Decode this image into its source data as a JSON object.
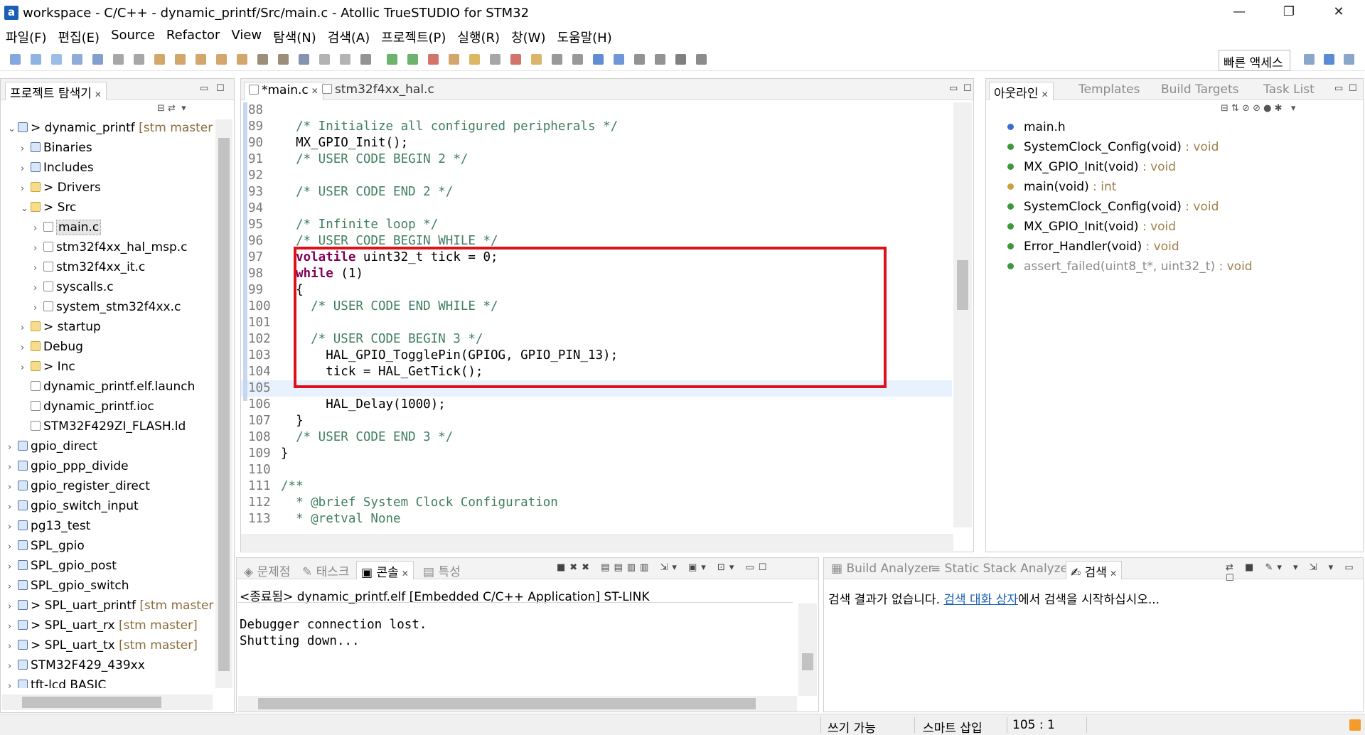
{
  "window": {
    "title": "workspace - C/C++ - dynamic_printf/Src/main.c - Atollic TrueSTUDIO for STM32",
    "logo": "a",
    "minimize": "—",
    "maximize": "❐",
    "close": "✕"
  },
  "menubar": [
    "파일(F)",
    "편집(E)",
    "Source",
    "Refactor",
    "View",
    "탐색(N)",
    "검색(A)",
    "프로젝트(P)",
    "실행(R)",
    "창(W)",
    "도움말(H)"
  ],
  "quick_access": "빠른 액세스",
  "explorer": {
    "tab_label": "프로젝트 탐색기",
    "items": [
      {
        "text": "dynamic_printf",
        "branch": "[stm master]",
        "prefix": "> ",
        "twisty": "v",
        "icon": "lib",
        "indent": 0
      },
      {
        "text": "Binaries",
        "branch": "",
        "prefix": "",
        "twisty": ">",
        "icon": "lib",
        "indent": 1
      },
      {
        "text": "Includes",
        "branch": "",
        "prefix": "",
        "twisty": ">",
        "icon": "lib",
        "indent": 1
      },
      {
        "text": "Drivers",
        "branch": "",
        "prefix": "> ",
        "twisty": ">",
        "icon": "fold",
        "indent": 1
      },
      {
        "text": "Src",
        "branch": "",
        "prefix": "> ",
        "twisty": "v",
        "icon": "fold",
        "indent": 1
      },
      {
        "text": "main.c",
        "branch": "",
        "prefix": "",
        "twisty": ">",
        "icon": "cfile",
        "indent": 2,
        "selected": true
      },
      {
        "text": "stm32f4xx_hal_msp.c",
        "branch": "",
        "prefix": "",
        "twisty": ">",
        "icon": "cfile",
        "indent": 2
      },
      {
        "text": "stm32f4xx_it.c",
        "branch": "",
        "prefix": "",
        "twisty": ">",
        "icon": "cfile",
        "indent": 2
      },
      {
        "text": "syscalls.c",
        "branch": "",
        "prefix": "",
        "twisty": ">",
        "icon": "cfile",
        "indent": 2
      },
      {
        "text": "system_stm32f4xx.c",
        "branch": "",
        "prefix": "",
        "twisty": ">",
        "icon": "cfile",
        "indent": 2
      },
      {
        "text": "startup",
        "branch": "",
        "prefix": "> ",
        "twisty": ">",
        "icon": "fold",
        "indent": 1
      },
      {
        "text": "Debug",
        "branch": "",
        "prefix": "",
        "twisty": ">",
        "icon": "fold",
        "indent": 1
      },
      {
        "text": "Inc",
        "branch": "",
        "prefix": "> ",
        "twisty": ">",
        "icon": "fold",
        "indent": 1
      },
      {
        "text": "dynamic_printf.elf.launch",
        "branch": "",
        "prefix": "",
        "twisty": "",
        "icon": "cfile",
        "indent": 1
      },
      {
        "text": "dynamic_printf.ioc",
        "branch": "",
        "prefix": "",
        "twisty": "",
        "icon": "cfile",
        "indent": 1
      },
      {
        "text": "STM32F429ZI_FLASH.ld",
        "branch": "",
        "prefix": "",
        "twisty": "",
        "icon": "cfile",
        "indent": 1
      },
      {
        "text": "gpio_direct",
        "branch": "",
        "prefix": "",
        "twisty": ">",
        "icon": "lib",
        "indent": 0
      },
      {
        "text": "gpio_ppp_divide",
        "branch": "",
        "prefix": "",
        "twisty": ">",
        "icon": "lib",
        "indent": 0
      },
      {
        "text": "gpio_register_direct",
        "branch": "",
        "prefix": "",
        "twisty": ">",
        "icon": "lib",
        "indent": 0
      },
      {
        "text": "gpio_switch_input",
        "branch": "",
        "prefix": "",
        "twisty": ">",
        "icon": "lib",
        "indent": 0
      },
      {
        "text": "pg13_test",
        "branch": "",
        "prefix": "",
        "twisty": ">",
        "icon": "lib",
        "indent": 0
      },
      {
        "text": "SPL_gpio",
        "branch": "",
        "prefix": "",
        "twisty": ">",
        "icon": "lib",
        "indent": 0
      },
      {
        "text": "SPL_gpio_post",
        "branch": "",
        "prefix": "",
        "twisty": ">",
        "icon": "lib",
        "indent": 0
      },
      {
        "text": "SPL_gpio_switch",
        "branch": "",
        "prefix": "",
        "twisty": ">",
        "icon": "lib",
        "indent": 0
      },
      {
        "text": "SPL_uart_printf",
        "branch": "[stm master]",
        "prefix": "> ",
        "twisty": ">",
        "icon": "lib",
        "indent": 0
      },
      {
        "text": "SPL_uart_rx",
        "branch": "[stm master]",
        "prefix": "> ",
        "twisty": ">",
        "icon": "lib",
        "indent": 0
      },
      {
        "text": "SPL_uart_tx",
        "branch": "[stm master]",
        "prefix": "> ",
        "twisty": ">",
        "icon": "lib",
        "indent": 0
      },
      {
        "text": "STM32F429_439xx",
        "branch": "",
        "prefix": "",
        "twisty": ">",
        "icon": "lib",
        "indent": 0
      },
      {
        "text": "tft-lcd BASIC",
        "branch": "",
        "prefix": "",
        "twisty": ">",
        "icon": "lib",
        "indent": 0
      }
    ]
  },
  "editor": {
    "tabs": [
      "*main.c",
      "stm32f4xx_hal.c"
    ],
    "lines": [
      {
        "n": "88",
        "code": ""
      },
      {
        "n": "89",
        "code": "  /* Initialize all configured peripherals */",
        "cls": "cm"
      },
      {
        "n": "90",
        "code": "  MX_GPIO_Init();"
      },
      {
        "n": "91",
        "code": "  /* USER CODE BEGIN 2 */",
        "cls": "cm"
      },
      {
        "n": "92",
        "code": ""
      },
      {
        "n": "93",
        "code": "  /* USER CODE END 2 */",
        "cls": "cm"
      },
      {
        "n": "94",
        "code": ""
      },
      {
        "n": "95",
        "code": "  /* Infinite loop */",
        "cls": "cm"
      },
      {
        "n": "96",
        "code": "  /* USER CODE BEGIN WHILE */",
        "cls": "cm"
      },
      {
        "n": "97",
        "code": "  volatile uint32_t tick = 0;",
        "kw": "volatile"
      },
      {
        "n": "98",
        "code": "  while (1)",
        "kw": "while"
      },
      {
        "n": "99",
        "code": "  {"
      },
      {
        "n": "100",
        "code": "    /* USER CODE END WHILE */",
        "cls": "cm"
      },
      {
        "n": "101",
        "code": ""
      },
      {
        "n": "102",
        "code": "    /* USER CODE BEGIN 3 */",
        "cls": "cm"
      },
      {
        "n": "103",
        "code": "      HAL_GPIO_TogglePin(GPIOG, GPIO_PIN_13);"
      },
      {
        "n": "104",
        "code": "      tick = HAL_GetTick();"
      },
      {
        "n": "105",
        "code": ""
      },
      {
        "n": "106",
        "code": "      HAL_Delay(1000);"
      },
      {
        "n": "107",
        "code": "  }"
      },
      {
        "n": "108",
        "code": "  /* USER CODE END 3 */",
        "cls": "cm"
      },
      {
        "n": "109",
        "code": "}"
      },
      {
        "n": "110",
        "code": ""
      },
      {
        "n": "111",
        "code": "/**",
        "cls": "cm"
      },
      {
        "n": "112",
        "code": "  * @brief System Clock Configuration",
        "cls": "cm"
      },
      {
        "n": "113",
        "code": "  * @retval None",
        "cls": "cm"
      }
    ]
  },
  "outline": {
    "tabs": [
      "아웃라인",
      "Templates",
      "Build Targets",
      "Task List"
    ],
    "items": [
      {
        "name": "main.h",
        "type": "",
        "color": "#3b6ccf"
      },
      {
        "name": "SystemClock_Config(void)",
        "type": " : void",
        "color": "#3a9a3a"
      },
      {
        "name": "MX_GPIO_Init(void)",
        "type": " : void",
        "color": "#3a9a3a"
      },
      {
        "name": "main(void)",
        "type": " : int",
        "color": "#c7a23e"
      },
      {
        "name": "SystemClock_Config(void)",
        "type": " : void",
        "color": "#3a9a3a"
      },
      {
        "name": "MX_GPIO_Init(void)",
        "type": " : void",
        "color": "#3a9a3a"
      },
      {
        "name": "Error_Handler(void)",
        "type": " : void",
        "color": "#3a9a3a"
      },
      {
        "name": "assert_failed(uint8_t*, uint32_t)",
        "type": " : void",
        "color": "#3a9a3a",
        "dim": true
      }
    ]
  },
  "console": {
    "tabs": [
      "문제점",
      "태스크",
      "콘솔",
      "특성"
    ],
    "header": "<종료됨> dynamic_printf.elf [Embedded C/C++ Application] ST-LINK",
    "output": [
      "Debugger connection lost.",
      "Shutting down..."
    ]
  },
  "search": {
    "tabs": [
      "Build Analyzer",
      "Static Stack Analyzer",
      "검색"
    ],
    "message_before": "검색 결과가 없습니다. ",
    "message_link": "검색 대화 상자",
    "message_after": "에서 검색을 시작하십시오..."
  },
  "status": {
    "mode": "쓰기 가능",
    "insert": "스마트 삽입",
    "position": "105 : 1"
  },
  "colors": {
    "highlight_box": "#e0101a",
    "comment": "#3f7f5f",
    "keyword": "#7f0055",
    "link": "#1a5fb4"
  }
}
